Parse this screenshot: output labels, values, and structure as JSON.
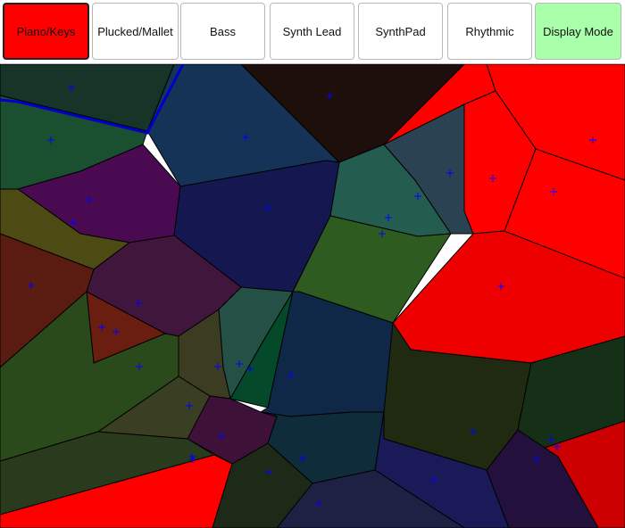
{
  "toolbar": {
    "buttons": [
      {
        "label": "Piano/Keys",
        "selected": true,
        "bg": "#ff0000"
      },
      {
        "label": "Plucked/Mallet",
        "selected": false,
        "bg": "#ffffff"
      },
      {
        "label": "Bass",
        "selected": false,
        "bg": "#ffffff"
      },
      {
        "label": "Synth Lead",
        "selected": false,
        "bg": "#ffffff"
      },
      {
        "label": "SynthPad",
        "selected": false,
        "bg": "#ffffff"
      },
      {
        "label": "Rhythmic",
        "selected": false,
        "bg": "#ffffff"
      },
      {
        "label": "Display Mode",
        "selected": false,
        "bg": "#aaffaa"
      }
    ]
  },
  "colors": {
    "highlight": "#ff0000",
    "seed_marker": "#0000ff",
    "selected_edge": "#0000cc"
  },
  "map_cells": [
    {
      "color": "#163428"
    },
    {
      "color": "#1a5030"
    },
    {
      "color": "#153356"
    },
    {
      "color": "#1f0f0c"
    },
    {
      "color": "#ff0000"
    },
    {
      "color": "#ff0000"
    },
    {
      "color": "#ff0000"
    },
    {
      "color": "#ff0000"
    },
    {
      "color": "#4a0a52"
    },
    {
      "color": "#151750"
    },
    {
      "color": "#245c50"
    },
    {
      "color": "#2a4252"
    },
    {
      "color": "#4d4a14"
    },
    {
      "color": "#5a1b10"
    },
    {
      "color": "#40163c"
    },
    {
      "color": "#2e5c20"
    },
    {
      "color": "#ee0000"
    },
    {
      "color": "#0f2848"
    },
    {
      "color": "#245046"
    },
    {
      "color": "#044a2a"
    },
    {
      "color": "#3c3c22"
    },
    {
      "color": "#6a1e10"
    },
    {
      "color": "#2a4a1c"
    },
    {
      "color": "#1f2a10"
    },
    {
      "color": "#163018"
    },
    {
      "color": "#cc0000"
    },
    {
      "color": "#3a3e22"
    },
    {
      "color": "#3e1238"
    },
    {
      "color": "#0e2c3a"
    },
    {
      "color": "#1a1a58"
    },
    {
      "color": "#24103c"
    },
    {
      "color": "#2a3a1c"
    },
    {
      "color": "#ff0000"
    },
    {
      "color": "#1e2a18"
    },
    {
      "color": "#1e2044"
    }
  ]
}
